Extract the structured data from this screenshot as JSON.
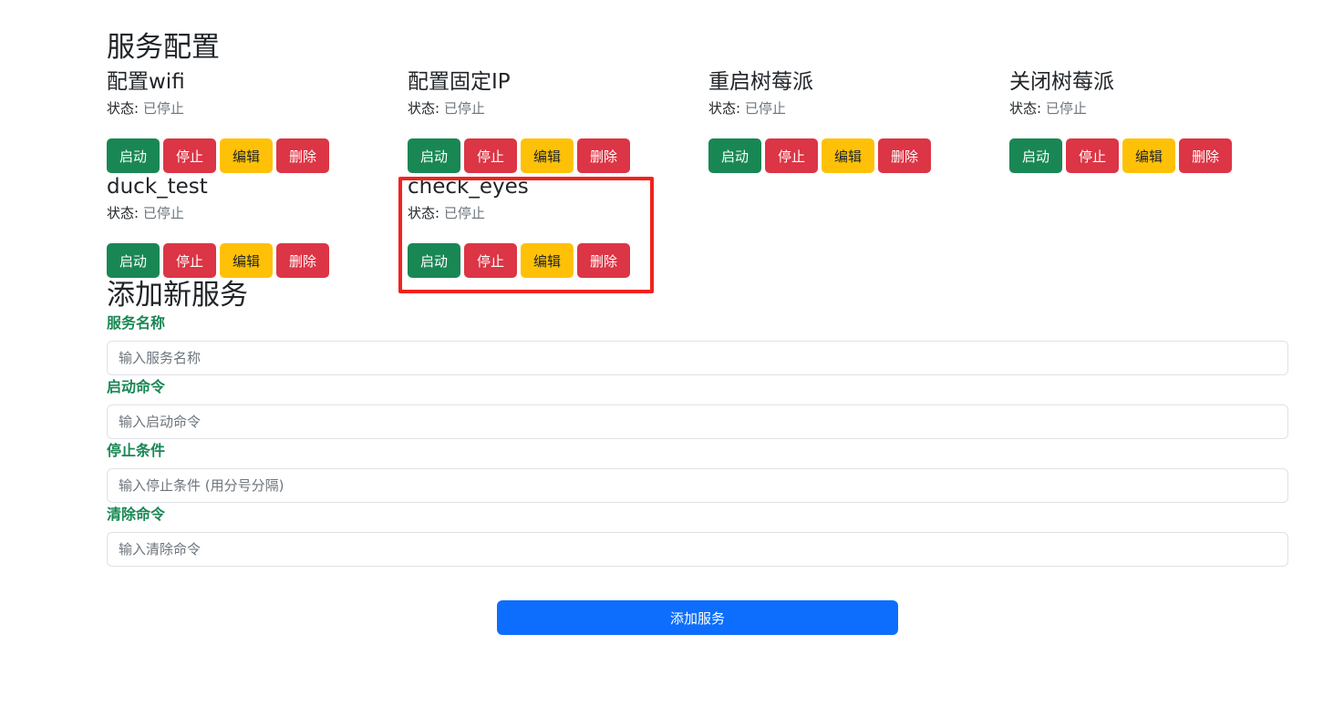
{
  "services_section": {
    "title": "服务配置",
    "status_label": "状态:",
    "buttons": {
      "start": "启动",
      "stop": "停止",
      "edit": "编辑",
      "delete": "删除"
    },
    "services": [
      {
        "name": "配置wifi",
        "status": "已停止"
      },
      {
        "name": "配置固定IP",
        "status": "已停止"
      },
      {
        "name": "重启树莓派",
        "status": "已停止"
      },
      {
        "name": "关闭树莓派",
        "status": "已停止"
      },
      {
        "name": "duck_test",
        "status": "已停止"
      },
      {
        "name": "check_eyes",
        "status": "已停止"
      }
    ]
  },
  "add_form": {
    "title": "添加新服务",
    "fields": [
      {
        "label": "服务名称",
        "placeholder": "输入服务名称"
      },
      {
        "label": "启动命令",
        "placeholder": "输入启动命令"
      },
      {
        "label": "停止条件",
        "placeholder": "输入停止条件 (用分号分隔)"
      },
      {
        "label": "清除命令",
        "placeholder": "输入清除命令"
      }
    ],
    "submit_label": "添加服务"
  },
  "colors": {
    "start": "#198754",
    "stop": "#dc3545",
    "edit": "#ffc107",
    "delete": "#dc3545",
    "primary": "#0d6efd",
    "label": "#198754",
    "highlight": "#f0231f"
  }
}
